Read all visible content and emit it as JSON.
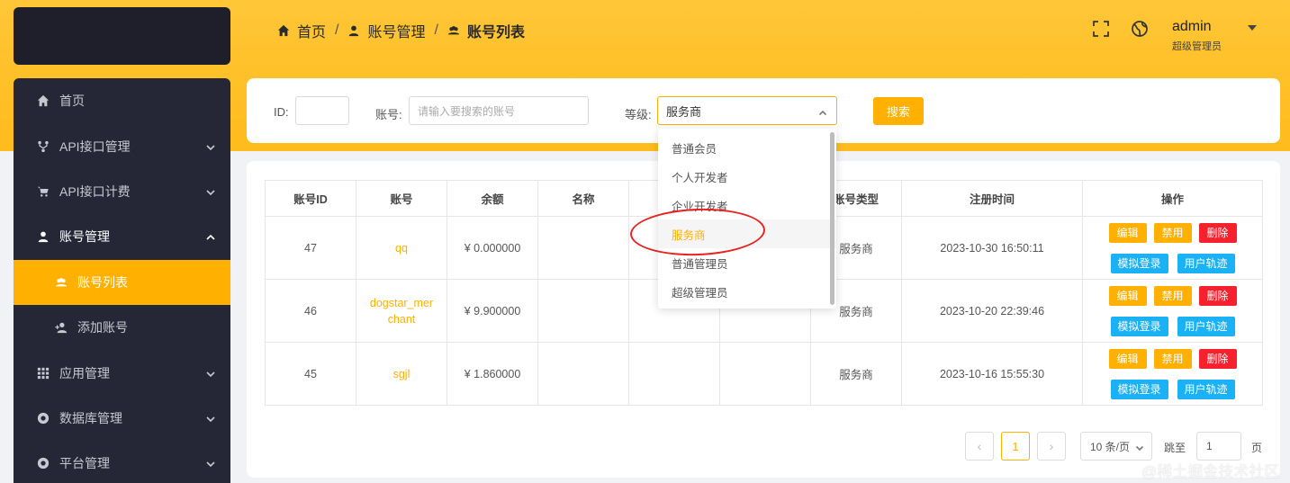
{
  "breadcrumb": {
    "home": "首页",
    "parent": "账号管理",
    "current": "账号列表"
  },
  "header": {
    "user_name": "admin",
    "user_role": "超级管理员",
    "fullscreen_icon": "fullscreen-icon",
    "globe_icon": "globe-icon"
  },
  "sidebar": {
    "items": [
      {
        "label": "首页",
        "icon": "home-icon"
      },
      {
        "label": "API接口管理",
        "icon": "api-icon"
      },
      {
        "label": "API接口计费",
        "icon": "cart-icon"
      },
      {
        "label": "账号管理",
        "icon": "user-icon"
      },
      {
        "label": "账号列表",
        "icon": "users-icon"
      },
      {
        "label": "添加账号",
        "icon": "add-user-icon"
      },
      {
        "label": "应用管理",
        "icon": "apps-icon"
      },
      {
        "label": "数据库管理",
        "icon": "database-icon"
      },
      {
        "label": "平台管理",
        "icon": "platform-icon"
      }
    ]
  },
  "search": {
    "id_label": "ID:",
    "id_value": "",
    "account_label": "账号:",
    "account_placeholder": "请输入要搜索的账号",
    "level_label": "等级:",
    "level_value": "服务商",
    "search_button": "搜索",
    "level_options": [
      "普通会员",
      "个人开发者",
      "企业开发者",
      "服务商",
      "普通管理员",
      "超级管理员"
    ]
  },
  "table": {
    "headers": [
      "账号ID",
      "账号",
      "余额",
      "名称",
      "",
      "",
      "账号类型",
      "注册时间",
      "操作"
    ],
    "rows": [
      {
        "id": "47",
        "account": "qq",
        "balance": "¥ 0.000000",
        "name": "",
        "c5": "",
        "c6": "",
        "type": "服务商",
        "time": "2023-10-30 16:50:11"
      },
      {
        "id": "46",
        "account": "dogstar_merchant",
        "balance": "¥ 9.900000",
        "name": "",
        "c5": "",
        "c6": "",
        "type": "服务商",
        "time": "2023-10-20 22:39:46"
      },
      {
        "id": "45",
        "account": "sgjl",
        "balance": "¥ 1.860000",
        "name": "",
        "c5": "",
        "c6": "",
        "type": "服务商",
        "time": "2023-10-16 15:55:30"
      }
    ],
    "ops": {
      "edit": "编辑",
      "ban": "禁用",
      "delete": "删除",
      "mock_login": "模拟登录",
      "trace": "用户轨迹"
    }
  },
  "pager": {
    "prev": "‹",
    "current": "1",
    "next": "›",
    "page_size": "10 条/页",
    "jump_label": "跳至",
    "jump_value": "1",
    "page_suffix": "页"
  },
  "watermark": "@稀土掘金技术社区",
  "colors": {
    "accent": "#ffb000",
    "danger": "#f5222d",
    "info": "#1ab2f5",
    "sidebar": "#252736"
  }
}
